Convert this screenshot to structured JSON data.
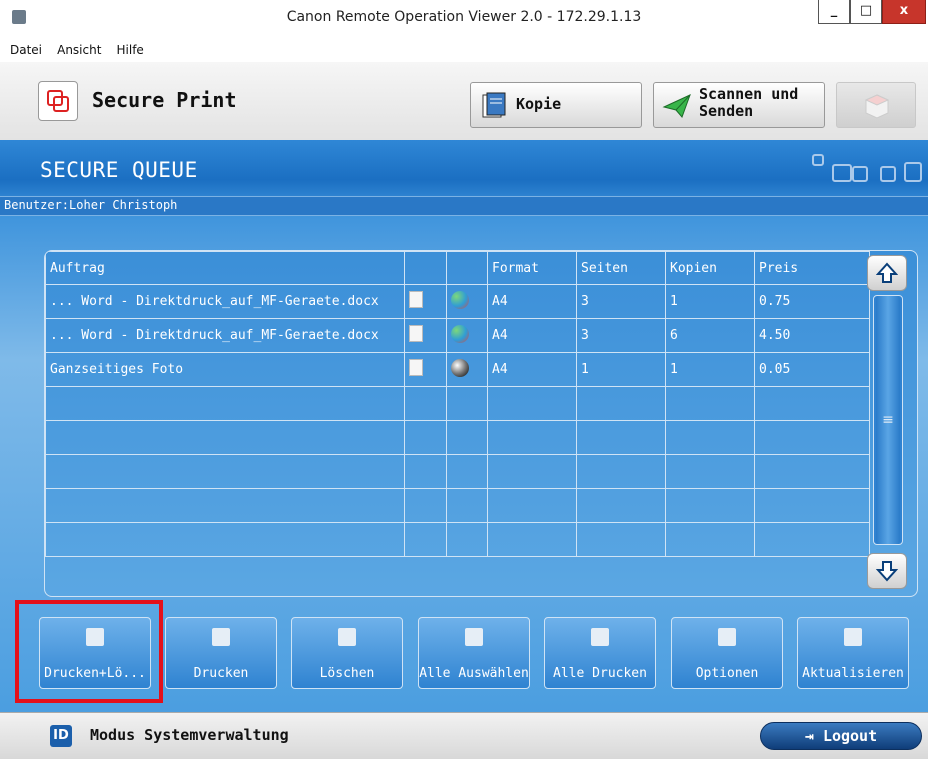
{
  "window": {
    "title": "Canon Remote Operation Viewer 2.0 - 172.29.1.13",
    "min": "_",
    "max": "□",
    "close": "x"
  },
  "menu": [
    "Datei",
    "Ansicht",
    "Hilfe"
  ],
  "header": {
    "title": "Secure Print",
    "kopie_label": "Kopie",
    "scan_label_1": "Scannen und",
    "scan_label_2": "Senden"
  },
  "queue": {
    "title": "SECURE QUEUE",
    "user": "Benutzer:Loher Christoph"
  },
  "table": {
    "columns": [
      "Auftrag",
      "",
      "",
      "Format",
      "Seiten",
      "Kopien",
      "Preis"
    ],
    "rows": [
      {
        "auftrag": "... Word - Direktdruck_auf_MF-Geraete.docx",
        "color": "color",
        "format": "A4",
        "seiten": "3",
        "kopien": "1",
        "preis": "0.75"
      },
      {
        "auftrag": "... Word - Direktdruck_auf_MF-Geraete.docx",
        "color": "color",
        "format": "A4",
        "seiten": "3",
        "kopien": "6",
        "preis": "4.50"
      },
      {
        "auftrag": "Ganzseitiges Foto",
        "color": "bw",
        "format": "A4",
        "seiten": "1",
        "kopien": "1",
        "preis": "0.05"
      }
    ],
    "empty_rows": 5
  },
  "actions": [
    "Drucken+Lö...",
    "Drucken",
    "Löschen",
    "Alle Auswählen",
    "Alle Drucken",
    "Optionen",
    "Aktualisieren"
  ],
  "footer": {
    "id_label": "ID",
    "mode": "Modus Systemverwaltung",
    "logout": "Logout"
  },
  "colors": {
    "accent": "#1b6fc2",
    "highlight": "#e4101a"
  }
}
